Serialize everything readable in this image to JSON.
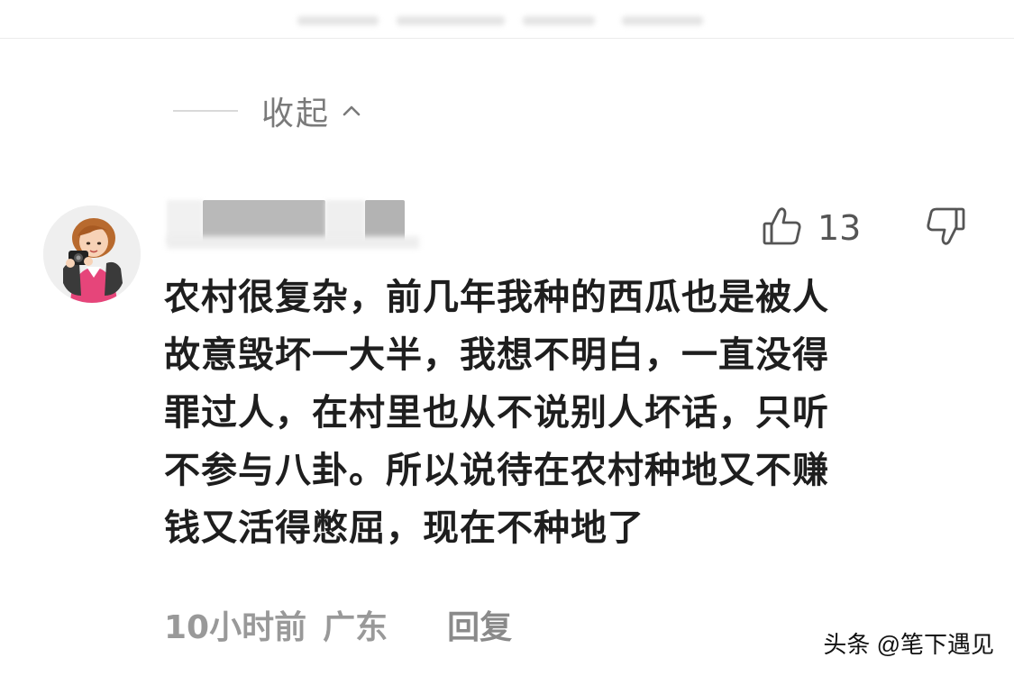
{
  "collapse": {
    "label": "收起",
    "icon": "chevron-up-icon"
  },
  "comment": {
    "avatar_icon": "user-avatar",
    "likes": "13",
    "like_icon": "thumbs-up-icon",
    "dislike_icon": "thumbs-down-icon",
    "text": "农村很复杂，前几年我种的西瓜也是被人\n故意毁坏一大半，我想不明白，一直没得\n罪过人，在村里也从不说别人坏话，只听\n不参与八卦。所以说待在农村种地又不赚\n钱又活得憋屈，现在不种地了",
    "time": "10小时前",
    "location": "广东",
    "reply_label": "回复"
  },
  "watermark": "头条 @笔下遇见"
}
